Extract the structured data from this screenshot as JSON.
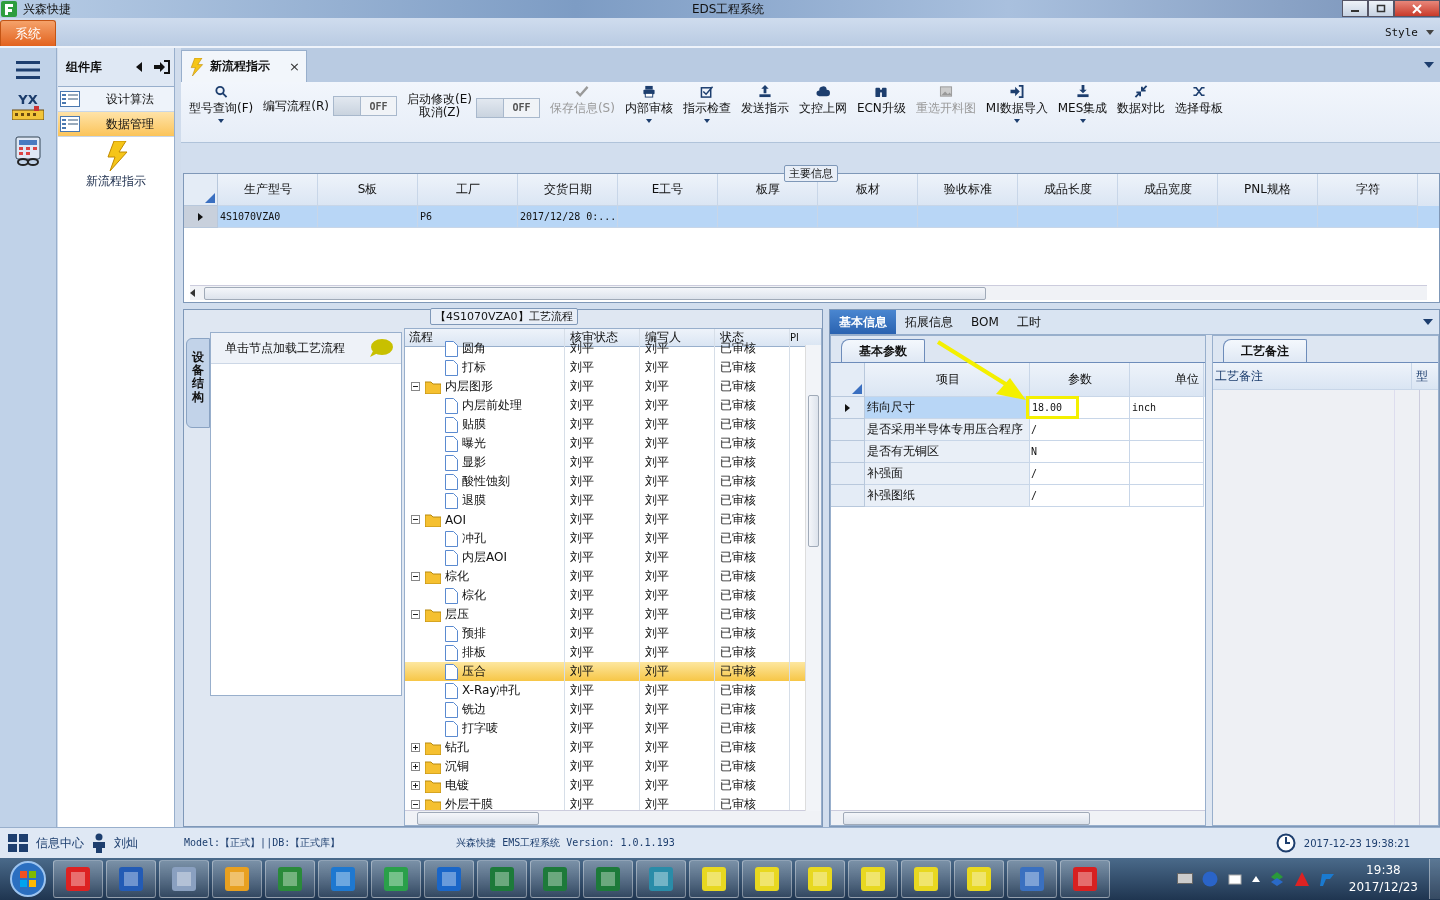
{
  "title_bar": {
    "app": "兴森快捷",
    "title": "EDS工程系统"
  },
  "menu_bar": {
    "tab": "系统",
    "style_label": "Style"
  },
  "rail": {
    "logo_text": "YX"
  },
  "component_panel": {
    "title": "组件库",
    "items": [
      {
        "label": "设计算法",
        "selected": false
      },
      {
        "label": "数据管理",
        "selected": true
      }
    ],
    "shortcut": "新流程指示"
  },
  "doc_tab": {
    "label": "新流程指示",
    "close": "×"
  },
  "toolbar": [
    {
      "kind": "button",
      "label": "型号查询(F)",
      "dropdown": true,
      "disabled": false
    },
    {
      "kind": "toggle",
      "label": "编写流程(R)",
      "state_text": "OFF",
      "on": false
    },
    {
      "kind": "toggle",
      "label": "启动修改(E)",
      "sublabel": "取消(Z)",
      "state_text": "OFF",
      "on": false
    },
    {
      "kind": "button",
      "label": "保存信息(S)",
      "dropdown": false,
      "disabled": true
    },
    {
      "kind": "button",
      "label": "内部审核",
      "dropdown": true,
      "disabled": false
    },
    {
      "kind": "button",
      "label": "指示检查",
      "dropdown": true,
      "disabled": false
    },
    {
      "kind": "button",
      "label": "发送指示",
      "dropdown": false,
      "disabled": false
    },
    {
      "kind": "button",
      "label": "文控上网",
      "dropdown": false,
      "disabled": false
    },
    {
      "kind": "button",
      "label": "ECN升级",
      "dropdown": false,
      "disabled": false
    },
    {
      "kind": "button",
      "label": "重选开料图",
      "dropdown": false,
      "disabled": true
    },
    {
      "kind": "button",
      "label": "MI数据导入",
      "dropdown": true,
      "disabled": false
    },
    {
      "kind": "button",
      "label": "MES集成",
      "dropdown": true,
      "disabled": false
    },
    {
      "kind": "button",
      "label": "数据对比",
      "dropdown": false,
      "disabled": false
    },
    {
      "kind": "button",
      "label": "选择母板",
      "dropdown": false,
      "disabled": false
    }
  ],
  "main_info": {
    "title": "主要信息",
    "columns": [
      "生产型号",
      "S板",
      "工厂",
      "交货日期",
      "E工号",
      "板厚",
      "板材",
      "验收标准",
      "成品长度",
      "成品宽度",
      "PNL规格",
      "字符"
    ],
    "rows": [
      {
        "selected": true,
        "cells": [
          "4S1070VZA0",
          null,
          "P6",
          "2017/12/28 0:...",
          null,
          null,
          null,
          null,
          null,
          null,
          null,
          null
        ]
      }
    ]
  },
  "process": {
    "title": "【4S1070VZA0】工艺流程",
    "side_tab": "设备结构",
    "hint": "单击节点加载工艺流程",
    "columns": [
      "流程",
      "核审状态",
      "编写人",
      "状态",
      "Pl"
    ],
    "tree": [
      {
        "kind": "continued",
        "children": [
          {
            "kind": "file",
            "label": "圆角",
            "reviewer": "刘平",
            "writer": "刘平",
            "status": "已审核",
            "selected": false
          },
          {
            "kind": "file",
            "label": "打标",
            "reviewer": "刘平",
            "writer": "刘平",
            "status": "已审核",
            "selected": false
          }
        ]
      },
      {
        "kind": "folder",
        "label": "内层图形",
        "reviewer": "刘平",
        "writer": "刘平",
        "status": "已审核",
        "selected": false,
        "expanded": true,
        "children": [
          {
            "kind": "file",
            "label": "内层前处理",
            "reviewer": "刘平",
            "writer": "刘平",
            "status": "已审核",
            "selected": false
          },
          {
            "kind": "file",
            "label": "贴膜",
            "reviewer": "刘平",
            "writer": "刘平",
            "status": "已审核",
            "selected": false
          },
          {
            "kind": "file",
            "label": "曝光",
            "reviewer": "刘平",
            "writer": "刘平",
            "status": "已审核",
            "selected": false
          },
          {
            "kind": "file",
            "label": "显影",
            "reviewer": "刘平",
            "writer": "刘平",
            "status": "已审核",
            "selected": false
          },
          {
            "kind": "file",
            "label": "酸性蚀刻",
            "reviewer": "刘平",
            "writer": "刘平",
            "status": "已审核",
            "selected": false
          },
          {
            "kind": "file",
            "label": "退膜",
            "reviewer": "刘平",
            "writer": "刘平",
            "status": "已审核",
            "selected": false
          }
        ]
      },
      {
        "kind": "folder",
        "label": "AOI",
        "reviewer": "刘平",
        "writer": "刘平",
        "status": "已审核",
        "selected": false,
        "expanded": true,
        "children": [
          {
            "kind": "file",
            "label": "冲孔",
            "reviewer": "刘平",
            "writer": "刘平",
            "status": "已审核",
            "selected": false
          },
          {
            "kind": "file",
            "label": "内层AOI",
            "reviewer": "刘平",
            "writer": "刘平",
            "status": "已审核",
            "selected": false
          }
        ]
      },
      {
        "kind": "folder",
        "label": "棕化",
        "reviewer": "刘平",
        "writer": "刘平",
        "status": "已审核",
        "selected": false,
        "expanded": true,
        "children": [
          {
            "kind": "file",
            "label": "棕化",
            "reviewer": "刘平",
            "writer": "刘平",
            "status": "已审核",
            "selected": false
          }
        ]
      },
      {
        "kind": "folder",
        "label": "层压",
        "reviewer": "刘平",
        "writer": "刘平",
        "status": "已审核",
        "selected": false,
        "expanded": true,
        "children": [
          {
            "kind": "file",
            "label": "预排",
            "reviewer": "刘平",
            "writer": "刘平",
            "status": "已审核",
            "selected": false
          },
          {
            "kind": "file",
            "label": "排板",
            "reviewer": "刘平",
            "writer": "刘平",
            "status": "已审核",
            "selected": false
          },
          {
            "kind": "file",
            "label": "压合",
            "reviewer": "刘平",
            "writer": "刘平",
            "status": "已审核",
            "selected": true
          },
          {
            "kind": "file",
            "label": "X-Ray冲孔",
            "reviewer": "刘平",
            "writer": "刘平",
            "status": "已审核",
            "selected": false
          },
          {
            "kind": "file",
            "label": "铣边",
            "reviewer": "刘平",
            "writer": "刘平",
            "status": "已审核",
            "selected": false
          },
          {
            "kind": "file",
            "label": "打字唛",
            "reviewer": "刘平",
            "writer": "刘平",
            "status": "已审核",
            "selected": false
          }
        ]
      },
      {
        "kind": "folder",
        "label": "钻孔",
        "reviewer": "刘平",
        "writer": "刘平",
        "status": "已审核",
        "selected": false,
        "expanded": false
      },
      {
        "kind": "folder",
        "label": "沉铜",
        "reviewer": "刘平",
        "writer": "刘平",
        "status": "已审核",
        "selected": false,
        "expanded": false
      },
      {
        "kind": "folder",
        "label": "电镀",
        "reviewer": "刘平",
        "writer": "刘平",
        "status": "已审核",
        "selected": false,
        "expanded": false
      },
      {
        "kind": "folder",
        "label": "外层干膜",
        "reviewer": "刘平",
        "writer": "刘平",
        "status": "已审核",
        "selected": false,
        "expanded": true
      }
    ]
  },
  "detail": {
    "tabs": [
      {
        "label": "基本信息",
        "selected": true
      },
      {
        "label": "拓展信息",
        "selected": false
      },
      {
        "label": "BOM",
        "selected": false
      },
      {
        "label": "工时",
        "selected": false
      }
    ],
    "params": {
      "title": "基本参数",
      "columns": [
        "项目",
        "参数",
        "单位"
      ],
      "rows": [
        {
          "item": "纬向尺寸",
          "value": "18.00",
          "unit": "inch",
          "selected": true,
          "callout": true
        },
        {
          "item": "是否采用半导体专用压合程序",
          "value": "/",
          "selected": false,
          "callout": false
        },
        {
          "item": "是否有无铜区",
          "value": "N",
          "selected": false,
          "callout": false
        },
        {
          "item": "补强面",
          "value": "/",
          "selected": false,
          "callout": false
        },
        {
          "item": "补强图纸",
          "value": "/",
          "selected": false,
          "callout": false
        }
      ]
    },
    "remarks": {
      "title": "工艺备注",
      "columns": [
        "工艺备注",
        "型"
      ]
    }
  },
  "status_bar": {
    "info_center": "信息中心",
    "user": "刘灿",
    "model": "Model:【正式】||DB:【正式库】",
    "version": "兴森快捷 EMS工程系统 Version: 1.0.1.193",
    "datetime": "2017-12-23 19:38:21"
  },
  "taskbar": {
    "time": "19:38",
    "date": "2017/12/23"
  }
}
